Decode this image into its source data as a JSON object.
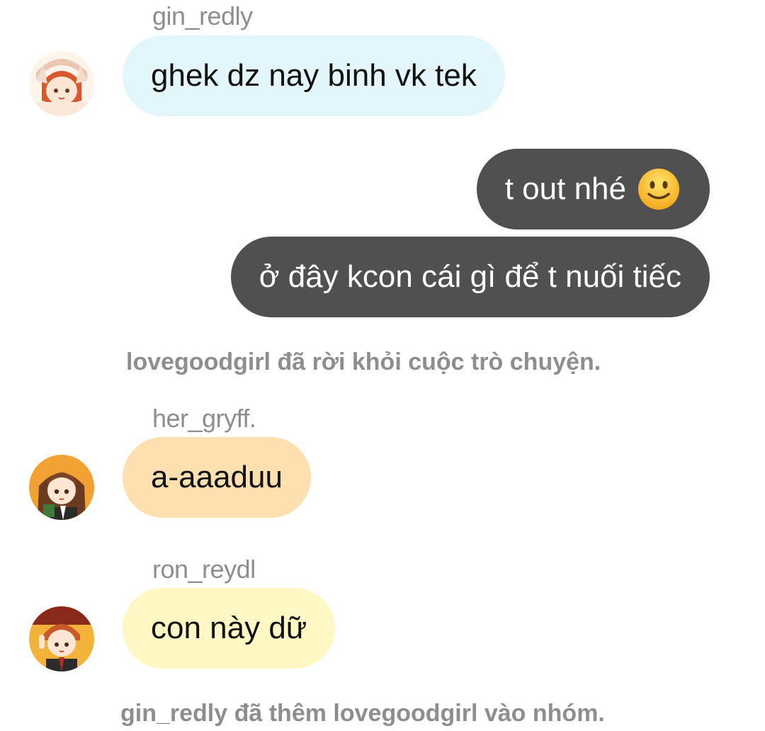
{
  "messages": [
    {
      "sender": "gin_redly",
      "text": "ghek dz nay binh vk tek",
      "color": "#e3f6fb",
      "avatar": "avatar-gin"
    },
    {
      "outgoing": true,
      "text": "t out nhé",
      "emoji": "slightly-smiling-face-icon"
    },
    {
      "outgoing": true,
      "text": "ở đây kcon cái gì để t nuối tiếc"
    },
    {
      "system": "lovegoodgirl đã rời khỏi cuộc trò chuyện."
    },
    {
      "sender": "her_gryff.",
      "text": "a-aaaduu",
      "color": "#fddfb0",
      "avatar": "avatar-her"
    },
    {
      "sender": "ron_reydl",
      "text": "con này dữ",
      "color": "#fff7c4",
      "avatar": "avatar-ron"
    },
    {
      "system": "gin_redly đã thêm lovegoodgirl vào nhóm."
    }
  ],
  "colors": {
    "outgoing_bubble": "#505050",
    "system_text": "#8e8e8e",
    "sender_text": "#8e8e8e"
  }
}
